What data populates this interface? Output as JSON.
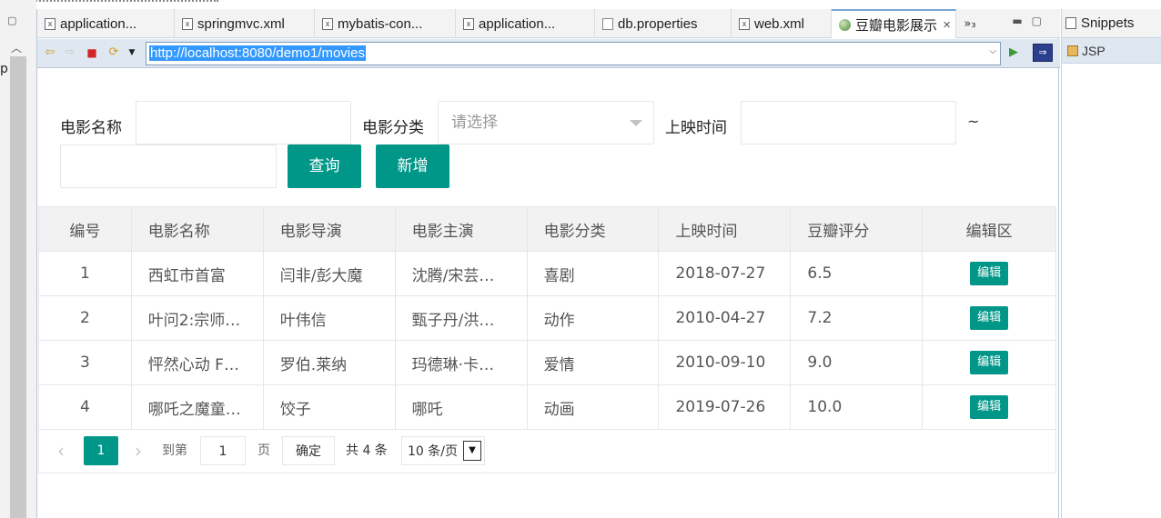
{
  "tabs": [
    {
      "label": "application...",
      "icon": "xml-file-icon"
    },
    {
      "label": "springmvc.xml",
      "icon": "xml-file-icon"
    },
    {
      "label": "mybatis-con...",
      "icon": "xml-file-icon"
    },
    {
      "label": "application...",
      "icon": "xml-file-icon"
    },
    {
      "label": "db.properties",
      "icon": "properties-file-icon"
    },
    {
      "label": "web.xml",
      "icon": "xml-file-icon"
    },
    {
      "label": "豆瓣电影展示",
      "icon": "globe-icon",
      "active": true
    }
  ],
  "tab_overflow": "»₃",
  "browser": {
    "url": "http://localhost:8080/demo1/movies"
  },
  "form": {
    "name_label": "电影名称",
    "name_value": "",
    "category_label": "电影分类",
    "category_placeholder": "请选择",
    "date_label": "上映时间",
    "date_from": "",
    "tilde": "~",
    "date_to": "",
    "search_button": "查询",
    "add_button": "新增"
  },
  "table": {
    "headers": [
      "编号",
      "电影名称",
      "电影导演",
      "电影主演",
      "电影分类",
      "上映时间",
      "豆瓣评分",
      "编辑区"
    ],
    "rows": [
      {
        "id": "1",
        "name": "西虹市首富",
        "director": "闫非/彭大魔",
        "cast": "沈腾/宋芸…",
        "category": "喜剧",
        "date": "2018-07-27",
        "rating": "6.5",
        "edit": "编辑"
      },
      {
        "id": "2",
        "name": "叶问2:宗师…",
        "director": "叶伟信",
        "cast": "甄子丹/洪…",
        "category": "动作",
        "date": "2010-04-27",
        "rating": "7.2",
        "edit": "编辑"
      },
      {
        "id": "3",
        "name": "怦然心动 F…",
        "director": "罗伯.莱纳",
        "cast": "玛德琳·卡…",
        "category": "爱情",
        "date": "2010-09-10",
        "rating": "9.0",
        "edit": "编辑"
      },
      {
        "id": "4",
        "name": "哪吒之魔童…",
        "director": "饺子",
        "cast": "哪吒",
        "category": "动画",
        "date": "2019-07-26",
        "rating": "10.0",
        "edit": "编辑"
      }
    ]
  },
  "pager": {
    "current_page": "1",
    "goto_label": "到第",
    "goto_value": "1",
    "page_label": "页",
    "confirm": "确定",
    "total": "共 4 条",
    "page_size": "10 条/页"
  },
  "right_panel": {
    "title": "Snippets",
    "item": "JSP"
  },
  "left_strip": {
    "char": "p"
  },
  "colors": {
    "primary": "#009688",
    "url_highlight": "#3399ff",
    "toolbar_bg": "#dfe7f1"
  }
}
